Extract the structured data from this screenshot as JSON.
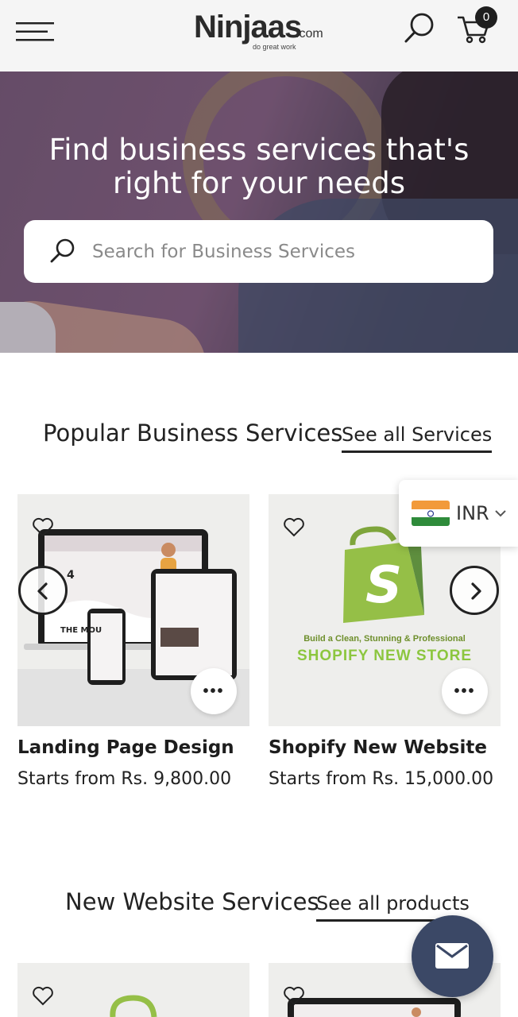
{
  "header": {
    "logo_text": "Ninjaas",
    "logo_suffix": ".com",
    "logo_tagline": "do great work",
    "cart_count": "0",
    "icons": {
      "menu": "hamburger-icon",
      "search": "search-icon",
      "cart": "cart-icon"
    }
  },
  "hero": {
    "title": "Find business services that's right for your needs",
    "search_placeholder": "Search for Business Services"
  },
  "popular": {
    "title": "Popular Business Services",
    "see_all": "See all Services",
    "products": [
      {
        "title": "Landing Page Design",
        "price": "Starts from Rs. 9,800.00",
        "image_text": "THE MOUNTAINS ARE WAITING FOR YOU"
      },
      {
        "title": "Shopify New Website",
        "price": "Starts from Rs. 15,000.00",
        "image_subtitle": "Build a Clean, Stunning & Professional",
        "image_title": "SHOPIFY NEW STORE"
      }
    ]
  },
  "new_website": {
    "title": "New Website Services",
    "see_all": "See all products"
  },
  "currency": {
    "code": "INR",
    "flag_colors": [
      "#f29a3a",
      "#ffffff",
      "#2e8b3a"
    ]
  },
  "colors": {
    "accent_dark": "#222222",
    "shopify_green": "#95bf47",
    "mail_button": "#3b4866"
  }
}
